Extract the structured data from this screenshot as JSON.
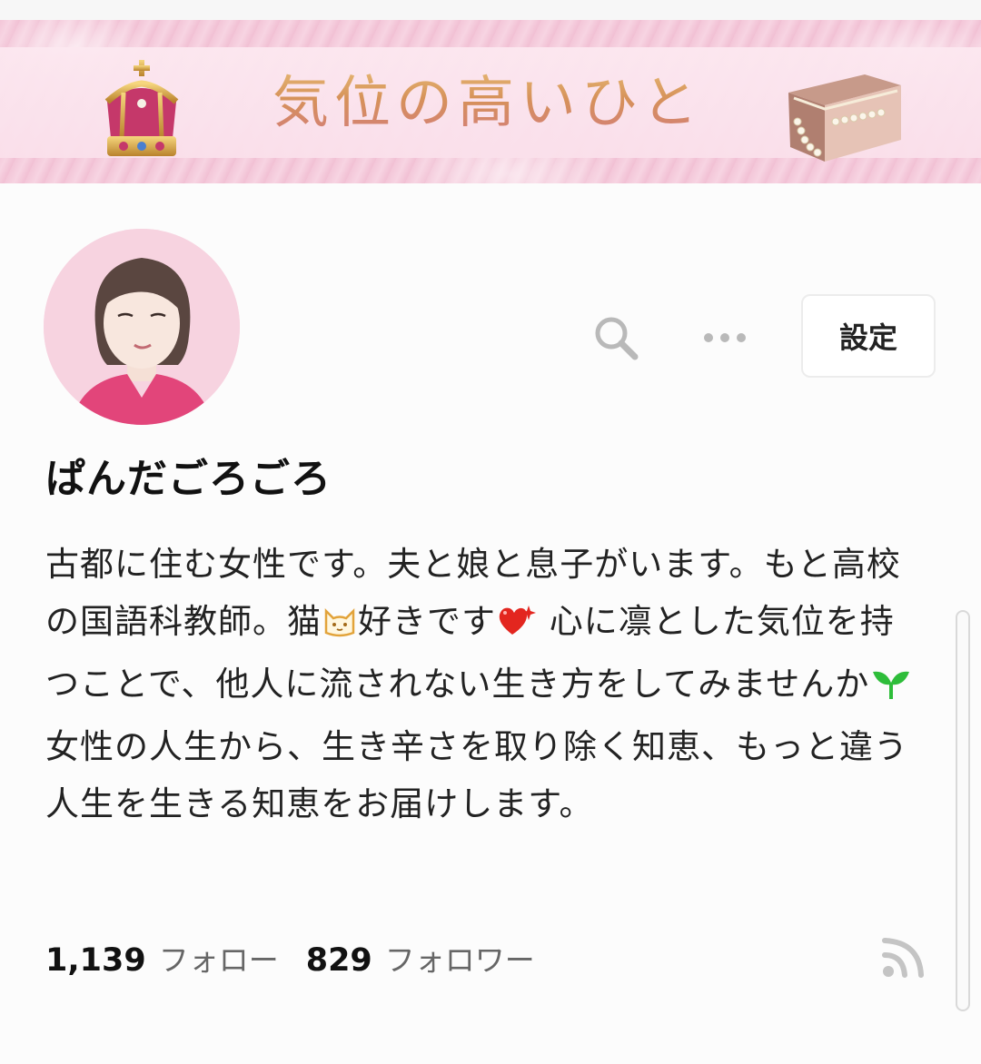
{
  "banner": {
    "title": "気位の高いひと",
    "left_icon": "crown-icon",
    "right_icon": "jewelry-box-icon"
  },
  "header": {
    "search_icon": "search-icon",
    "more_icon": "more-horizontal-icon",
    "settings_label": "設定"
  },
  "profile": {
    "avatar_icon": "avatar-woman-icon",
    "username": "ぱんだごろごろ",
    "bio": {
      "part1": "古都に住む女性です。夫と娘と息子がいます。もと高校の国語科教師。猫",
      "part2": "好きです",
      "part3": " 心に凛とした気位を持つことで、他人に流されない生き方をしてみませんか",
      "part4": " 女性の人生から、生き辛さを取り除く知恵、もっと違う人生を生きる知恵をお届けします。",
      "emoji1": "cat-face-icon",
      "emoji2": "sparkling-heart-icon",
      "emoji3": "seedling-icon"
    }
  },
  "stats": {
    "following_count": "1,139",
    "following_label": "フォロー",
    "followers_count": "829",
    "followers_label": "フォロワー"
  },
  "rss_icon": "rss-icon",
  "colors": {
    "banner_pink": "#f4c9da",
    "title_gold": "#d8a24a",
    "text_dark": "#222222",
    "muted_gray": "#666666"
  }
}
